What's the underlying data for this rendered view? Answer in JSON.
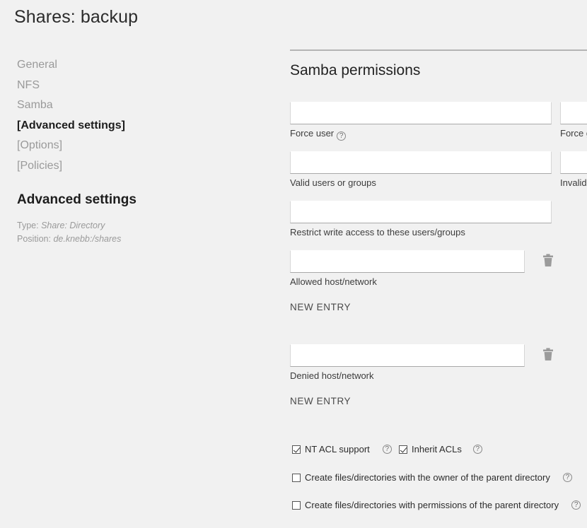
{
  "page": {
    "title": "Shares: backup"
  },
  "sidebar": {
    "items": [
      {
        "label": "General",
        "active": false
      },
      {
        "label": "NFS",
        "active": false
      },
      {
        "label": "Samba",
        "active": false
      },
      {
        "label": "[Advanced settings]",
        "active": true
      },
      {
        "label": "[Options]",
        "active": false
      },
      {
        "label": "[Policies]",
        "active": false
      }
    ],
    "section_heading": "Advanced settings",
    "meta": [
      {
        "key": "Type:",
        "value": "Share: Directory"
      },
      {
        "key": "Position:",
        "value": "de.knebb:/shares"
      }
    ]
  },
  "panel": {
    "heading": "Samba permissions",
    "fields": {
      "force_user": {
        "label": "Force user",
        "value": "",
        "help": "?"
      },
      "force_group": {
        "label": "Force group",
        "value": "",
        "help": "?"
      },
      "valid_users": {
        "label": "Valid users or groups",
        "value": ""
      },
      "invalid_users": {
        "label": "Invalid users or groups",
        "value": ""
      },
      "restrict_write": {
        "label": "Restrict write access to these users/groups",
        "value": ""
      },
      "allowed_host": {
        "label": "Allowed host/network",
        "value": ""
      },
      "denied_host": {
        "label": "Denied host/network",
        "value": ""
      }
    },
    "new_entry_label": "NEW ENTRY",
    "checkboxes": [
      {
        "label": "NT ACL support",
        "checked": true,
        "help": "?"
      },
      {
        "label": "Inherit ACLs",
        "checked": true,
        "help": "?"
      },
      {
        "label": "Create files/directories with the owner of the parent directory",
        "checked": false,
        "help": "?"
      },
      {
        "label": "Create files/directories with permissions of the parent directory",
        "checked": false,
        "help": "?"
      }
    ]
  },
  "icons": {
    "trash": "trash-icon",
    "help": "help-circle-icon"
  },
  "colors": {
    "background": "#f1f1f1",
    "text": "#2a2a2a",
    "muted": "#9a9a9a",
    "rule": "#b4b4b4",
    "field_underline": "#a9a9a9"
  }
}
